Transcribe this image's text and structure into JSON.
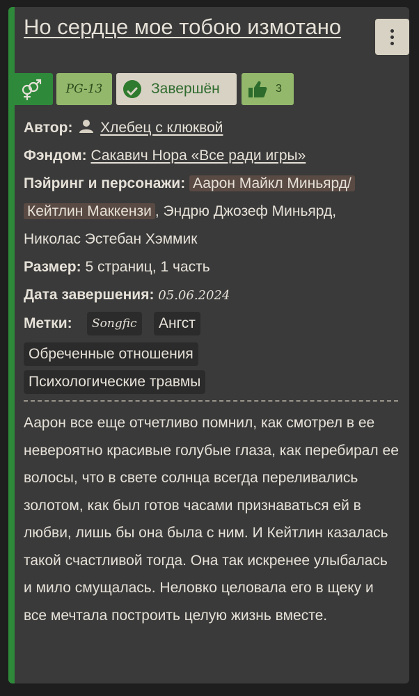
{
  "work": {
    "title": "Но сердце мое тобою измотано",
    "badges": {
      "direction_icon": "gender-symbol-icon",
      "rating": "PG-13",
      "status": "Завершён",
      "likes": "3"
    },
    "author": {
      "label": "Автор",
      "value": "Хлебец с клюквой"
    },
    "fandom": {
      "label": "Фэндом",
      "value": "Сакавич Нора «Все ради игры»"
    },
    "pairing": {
      "label": "Пэйринг и персонажи",
      "pair_line1": "Аарон Майкл Миньярд/",
      "pair_line2": "Кейтлин Маккензи",
      "rest_line2": ", Эндрю Джозеф Миньярд,",
      "line3": "Николас Эстебан Хэммик"
    },
    "size": {
      "label": "Размер",
      "value": "5 страниц, 1 часть"
    },
    "date": {
      "label": "Дата завершения",
      "value": "05.06.2024"
    },
    "tags": {
      "label": "Метки",
      "items": [
        "Songfic",
        "Ангст",
        "Обреченные отношения",
        "Психологические травмы"
      ]
    },
    "description": "Аарон все еще отчетливо помнил, как смотрел в ее невероятно красивые голубые глаза, как перебирал ее волосы, что в свете солнца всегда переливались золотом, как был готов часами признаваться ей в любви, лишь бы она была с ним. И Кейтлин казалась такой счастливой тогда. Она так искренее улыбалась и мило смущалась. Неловко целовала его в щеку и все мечтала построить целую жизнь вместе.",
    "colors": {
      "accent_green": "#2e8a3a",
      "rating_bg": "#93b86b",
      "status_bg": "#d8d2c4",
      "card_bg": "#3a3a3a"
    }
  }
}
